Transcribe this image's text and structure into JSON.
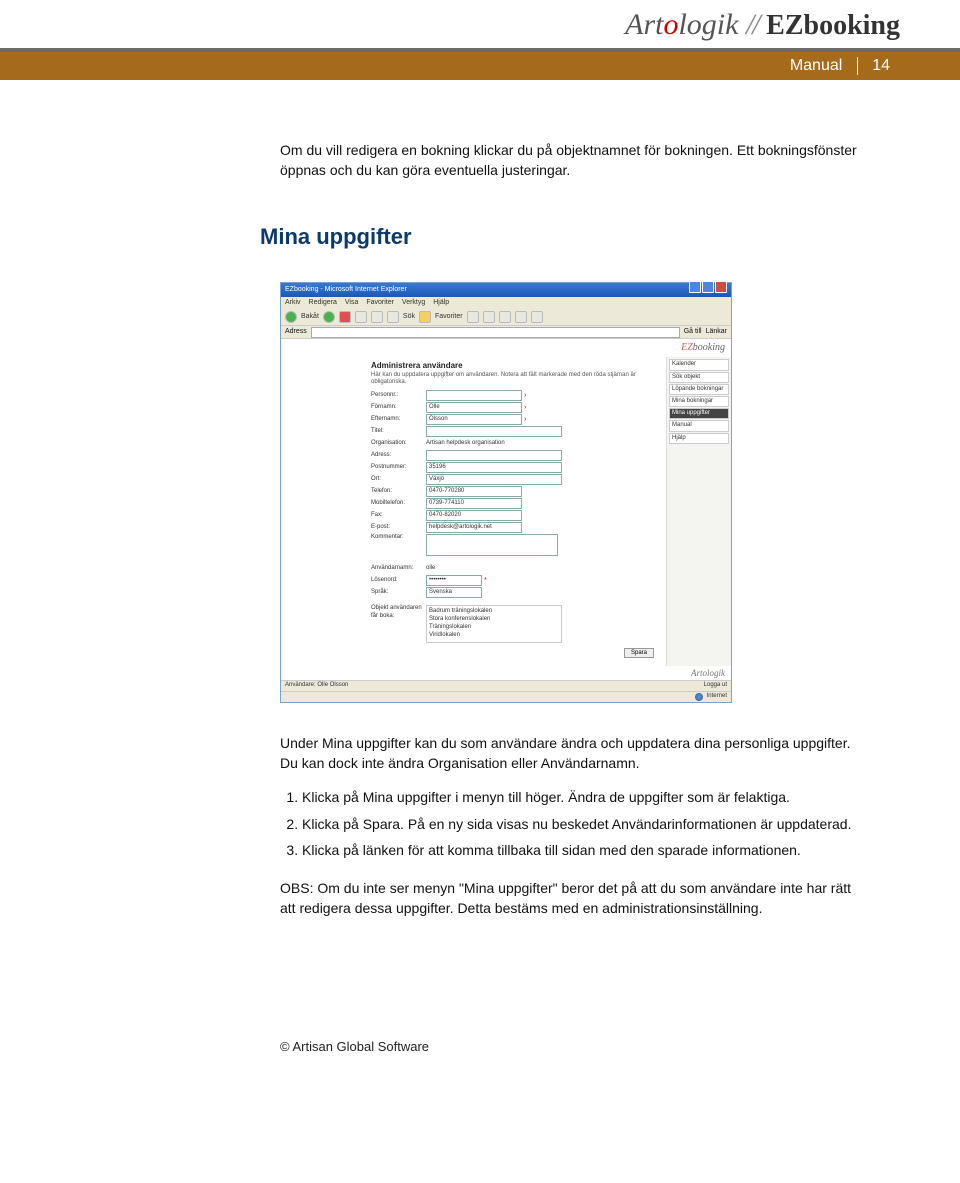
{
  "header": {
    "logo_part1": "Art",
    "logo_part2": "o",
    "logo_part3": "logik",
    "logo_slashes": "//",
    "logo_ez": "EZbooking",
    "bar_label": "Manual",
    "page_number": "14"
  },
  "body": {
    "para1": "Om du vill redigera en bokning klickar du på objektnamnet för bokningen. Ett bokningsfönster öppnas och du kan göra eventuella justeringar.",
    "section_title": "Mina uppgifter",
    "para2": "Under Mina uppgifter kan du som användare ändra och uppdatera dina personliga uppgifter. Du kan dock inte ändra Organisation eller Användarnamn.",
    "steps": [
      "Klicka på Mina uppgifter i menyn till höger. Ändra de uppgifter som är felaktiga.",
      "Klicka på Spara. På en ny sida visas nu beskedet Användarinformationen är uppdaterad.",
      "Klicka på länken för att komma tillbaka till sidan med den sparade informationen."
    ],
    "obs": "OBS: Om du inte ser menyn \"Mina uppgifter\" beror det på att du som användare inte har rätt att redigera dessa uppgifter. Detta bestäms med en administrationsinställning."
  },
  "screenshot": {
    "window_title": "EZbooking - Microsoft Internet Explorer",
    "menu": [
      "Arkiv",
      "Redigera",
      "Visa",
      "Favoriter",
      "Verktyg",
      "Hjälp"
    ],
    "toolbar": {
      "back": "Bakåt",
      "sok": "Sök",
      "fav": "Favoriter"
    },
    "addr_label": "Adress",
    "go": "Gå till",
    "links": "Länkar",
    "app_logo": "EZbooking",
    "page_title": "Administrera användare",
    "subtitle": "Här kan du uppdatera uppgifter om användaren. Notera att fält markerade med den röda stjärnan är obligatoriska.",
    "side_menu": [
      "Kalender",
      "Sök objekt",
      "Löpande bokningar",
      "Mina bokningar",
      "Mina uppgifter",
      "Manual",
      "Hjälp"
    ],
    "fields": {
      "personnr": {
        "label": "Personnr.:",
        "value": ""
      },
      "fornamn": {
        "label": "Förnamn:",
        "value": "Olle"
      },
      "efternamn": {
        "label": "Efternamn:",
        "value": "Olsson"
      },
      "titel": {
        "label": "Titel:",
        "value": ""
      },
      "organisation": {
        "label": "Organisation:",
        "value": "Artisan helpdesk organisation"
      },
      "adress": {
        "label": "Adress:",
        "value": ""
      },
      "postnummer": {
        "label": "Postnummer:",
        "value": "35196"
      },
      "ort": {
        "label": "Ort:",
        "value": "Växjö"
      },
      "telefon": {
        "label": "Telefon:",
        "value": "0470-770280"
      },
      "mobiltelefon": {
        "label": "Mobiltelefon:",
        "value": "0739-774110"
      },
      "fax": {
        "label": "Fax:",
        "value": "0470-82020"
      },
      "epost": {
        "label": "E-post:",
        "value": "helpdesk@artologik.net"
      },
      "kommentar": {
        "label": "Kommentar:",
        "value": ""
      },
      "anvandarnamn": {
        "label": "Användarnamn:",
        "value": "olle"
      },
      "losenord": {
        "label": "Lösenord:",
        "value": "••••••••"
      },
      "sprak": {
        "label": "Språk:",
        "value": "Svenska"
      }
    },
    "objects_label": "Objekt användaren får boka:",
    "objects": [
      "Badrum träningslokalen",
      "Stora konferenslokalen",
      "Träningslokalen",
      "Viridlokalen"
    ],
    "save_btn": "Spara",
    "footer_logo": "Artologik",
    "status_user": "Användare: Olle Olsson",
    "status_logout": "Logga ut",
    "status_zone": "Internet"
  },
  "footer": "© Artisan Global Software"
}
